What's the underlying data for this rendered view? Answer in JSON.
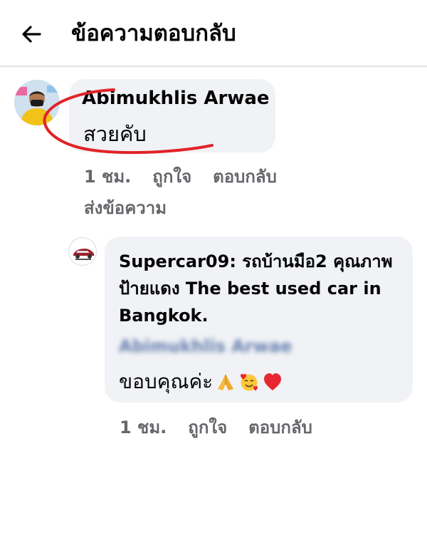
{
  "header": {
    "title": "ข้อความตอบกลับ",
    "back_icon": "arrow-left-icon"
  },
  "comment": {
    "author": "Abimukhlis Arwae",
    "text": "สวยคับ",
    "time": "1 ชม.",
    "like_label": "ถูกใจ",
    "reply_label": "ตอบกลับ",
    "send_message_label": "ส่งข้อความ",
    "annotation_color": "#e0242a"
  },
  "reply": {
    "text": "Supercar09: รถบ้านมือ2 คุณภาพป้ายแดง The best used car in Bangkok.",
    "mention": "Abimukhlis Arwae",
    "thanks": "ขอบคุณค่ะ",
    "emojis": [
      "folded-hands-icon",
      "smiling-face-with-hearts-icon",
      "red-heart-icon"
    ],
    "time": "1 ชม.",
    "like_label": "ถูกใจ",
    "reply_label": "ตอบกลับ"
  },
  "colors": {
    "bubble": "#f0f2f5",
    "meta_text": "#65676b",
    "mention": "#385898"
  }
}
